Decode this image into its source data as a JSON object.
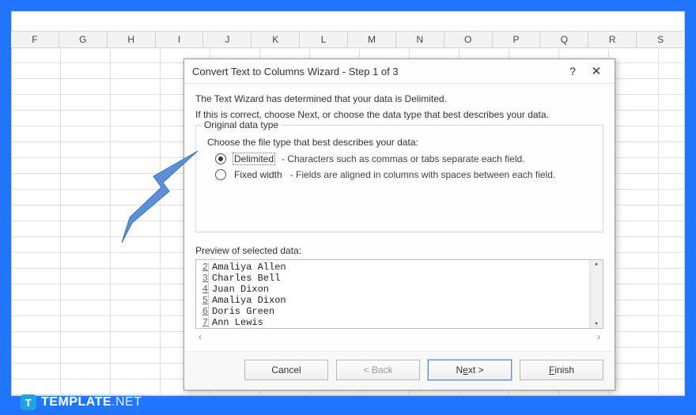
{
  "columns": [
    "F",
    "G",
    "H",
    "I",
    "J",
    "K",
    "L",
    "M",
    "N",
    "O",
    "P",
    "Q",
    "R",
    "S"
  ],
  "dialog": {
    "title": "Convert Text to Columns Wizard - Step 1 of 3",
    "line1": "The Text Wizard has determined that your data is Delimited.",
    "line2": "If this is correct, choose Next, or choose the data type that best describes your data.",
    "legend": "Original data type",
    "choiceLead": "Choose the file type that best describes your data:",
    "radios": [
      {
        "label": "Delimited",
        "desc": "-  Characters such as commas or tabs separate each field.",
        "checked": true,
        "focused": true
      },
      {
        "label": "Fixed width",
        "desc": "-  Fields are aligned in columns with spaces between each field.",
        "checked": false,
        "focused": false
      }
    ],
    "previewLabel": "Preview of selected data:",
    "previewRows": [
      {
        "n": "2",
        "text": "Amaliya Allen"
      },
      {
        "n": "3",
        "text": "Charles Bell"
      },
      {
        "n": "4",
        "text": "Juan Dixon"
      },
      {
        "n": "5",
        "text": "Amaliya Dixon"
      },
      {
        "n": "6",
        "text": "Doris Green"
      },
      {
        "n": "7",
        "text": "Ann Lewis"
      }
    ],
    "buttons": {
      "cancel": "Cancel",
      "back": "< Back",
      "nextPrefix": "N",
      "nextLetter": "e",
      "nextSuffix": "xt >",
      "finishPrefix": "",
      "finishLetter": "F",
      "finishSuffix": "inish"
    }
  },
  "watermark": {
    "brand": "TEMPLATE",
    "suffix": ".NET",
    "badge": "T"
  }
}
